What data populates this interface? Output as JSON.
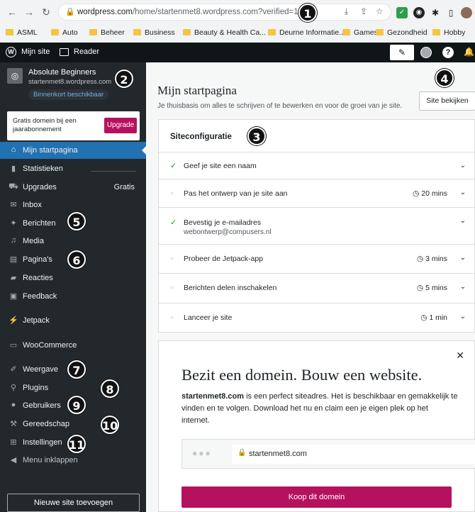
{
  "browser": {
    "url_host": "wordpress.com",
    "url_rest": "/home/startenmet8.wordpress.com?verified=1",
    "bookmarks": [
      "ASML",
      "Auto",
      "Beheer",
      "Business",
      "Beauty & Health Ca...",
      "Deurne Informatie...",
      "Games",
      "Gezondheid",
      "Hobby"
    ]
  },
  "masterbar": {
    "my_site": "Mijn site",
    "reader": "Reader"
  },
  "sidebar": {
    "site_name": "Absolute Beginners",
    "site_url": "startenmet8.wordpress.com",
    "badge": "Binnenkort beschikbaar",
    "upgrade_text": "Gratis domein bij een jaarabonnement",
    "upgrade_button": "Upgrade",
    "items": [
      {
        "label": "Mijn startpagina",
        "icon": "home-icon",
        "extra": ""
      },
      {
        "label": "Statistieken",
        "icon": "stats-icon",
        "extra": ""
      },
      {
        "label": "Upgrades",
        "icon": "cart-icon",
        "extra": "Gratis"
      },
      {
        "label": "Inbox",
        "icon": "mail-icon",
        "extra": ""
      },
      {
        "label": "Berichten",
        "icon": "pin-icon",
        "extra": ""
      },
      {
        "label": "Media",
        "icon": "media-icon",
        "extra": ""
      },
      {
        "label": "Pagina's",
        "icon": "page-icon",
        "extra": ""
      },
      {
        "label": "Reacties",
        "icon": "comment-icon",
        "extra": ""
      },
      {
        "label": "Feedback",
        "icon": "feedback-icon",
        "extra": ""
      },
      {
        "label": "Jetpack",
        "icon": "jetpack-icon",
        "extra": ""
      },
      {
        "label": "WooCommerce",
        "icon": "woo-icon",
        "extra": ""
      },
      {
        "label": "Weergave",
        "icon": "brush-icon",
        "extra": ""
      },
      {
        "label": "Plugins",
        "icon": "plugin-icon",
        "extra": ""
      },
      {
        "label": "Gebruikers",
        "icon": "user-icon",
        "extra": ""
      },
      {
        "label": "Gereedschap",
        "icon": "wrench-icon",
        "extra": ""
      },
      {
        "label": "Instellingen",
        "icon": "settings-icon",
        "extra": ""
      },
      {
        "label": "Menu inklappen",
        "icon": "collapse-icon",
        "extra": ""
      }
    ],
    "add_site": "Nieuwe site toevoegen"
  },
  "main": {
    "title": "Mijn startpagina",
    "subtitle": "Je thuisbasis om alles te schrijven of te bewerken en voor de groei van je site.",
    "view_site": "Site bekijken",
    "config": {
      "title": "Siteconfiguratie",
      "tasks": [
        {
          "label": "Geef je site een naam",
          "done": true,
          "time": "",
          "sub": ""
        },
        {
          "label": "Pas het ontwerp van je site aan",
          "done": false,
          "time": "20 mins",
          "sub": ""
        },
        {
          "label": "Bevestig je e-mailadres",
          "done": true,
          "time": "",
          "sub": "webontwerp@compusers.nl"
        },
        {
          "label": "Probeer de Jetpack-app",
          "done": false,
          "time": "3 mins",
          "sub": ""
        },
        {
          "label": "Berichten delen inschakelen",
          "done": false,
          "time": "5 mins",
          "sub": ""
        },
        {
          "label": "Lanceer je site",
          "done": false,
          "time": "1 min",
          "sub": ""
        }
      ]
    },
    "domain": {
      "heading": "Bezit een domein. Bouw een website.",
      "text_bold": "startenmet8.com",
      "text_rest": " is een perfect siteadres. Het is beschikbaar en gemakkelijk te vinden en te volgen. Download het nu en claim een je eigen plek op het internet.",
      "preview_url": "startenmet8.com",
      "buy_button": "Koop dit domein"
    }
  },
  "callouts": [
    "1",
    "2",
    "3",
    "4",
    "5",
    "6",
    "7",
    "8",
    "9",
    "10",
    "11"
  ],
  "colors": {
    "accent": "#2271b1",
    "brand_pink": "#b5115e",
    "sidebar_bg": "#23282d",
    "check": "#00a32a"
  }
}
